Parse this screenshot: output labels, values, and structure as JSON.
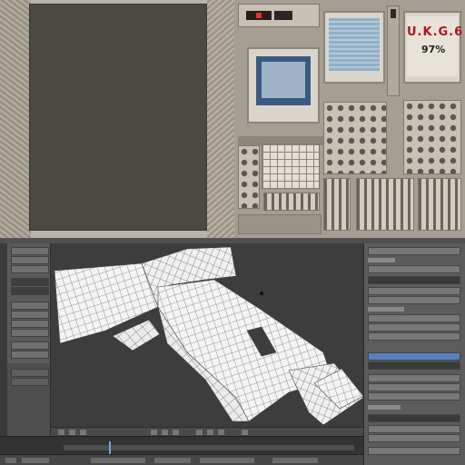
{
  "reference_photo": {
    "display_text": "U.K.G.6",
    "percent_text": "97%",
    "readout_color": "#d33333",
    "text_color": "#b3141a"
  },
  "blender": {
    "viewport": {
      "mesh": "wireframe-mesh",
      "background_color": "#3d3d3d"
    },
    "timeline": {
      "cursor_color": "#6fa8dc"
    }
  }
}
